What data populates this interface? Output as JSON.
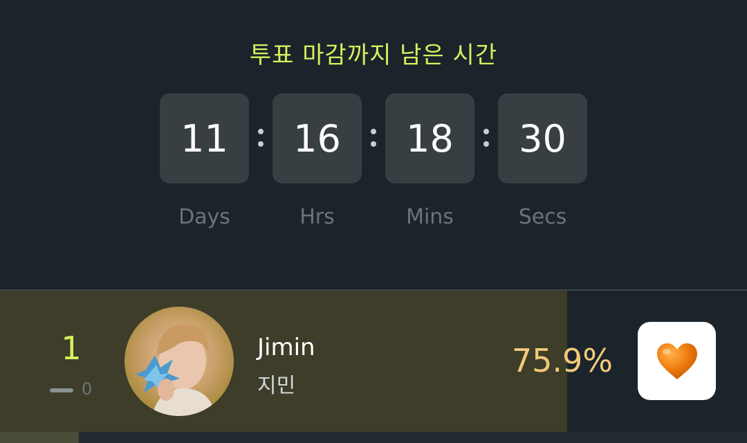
{
  "countdown": {
    "title": "투표 마감까지 남은 시간",
    "days": "11",
    "hours": "16",
    "minutes": "18",
    "seconds": "30",
    "labels": {
      "days": "Days",
      "hours": "Hrs",
      "minutes": "Mins",
      "seconds": "Secs"
    }
  },
  "ranking": {
    "items": [
      {
        "rank": "1",
        "change": "0",
        "name_en": "Jimin",
        "name_ko": "지민",
        "percent": "75.9%",
        "vote_fraction": 0.759,
        "vote_icon": "orange-heart-icon"
      }
    ]
  },
  "colors": {
    "accent": "#d8f060",
    "percent": "#f2c97b",
    "background": "#1b242a",
    "timer_box": "#373f43",
    "heart": "#f07d10"
  }
}
